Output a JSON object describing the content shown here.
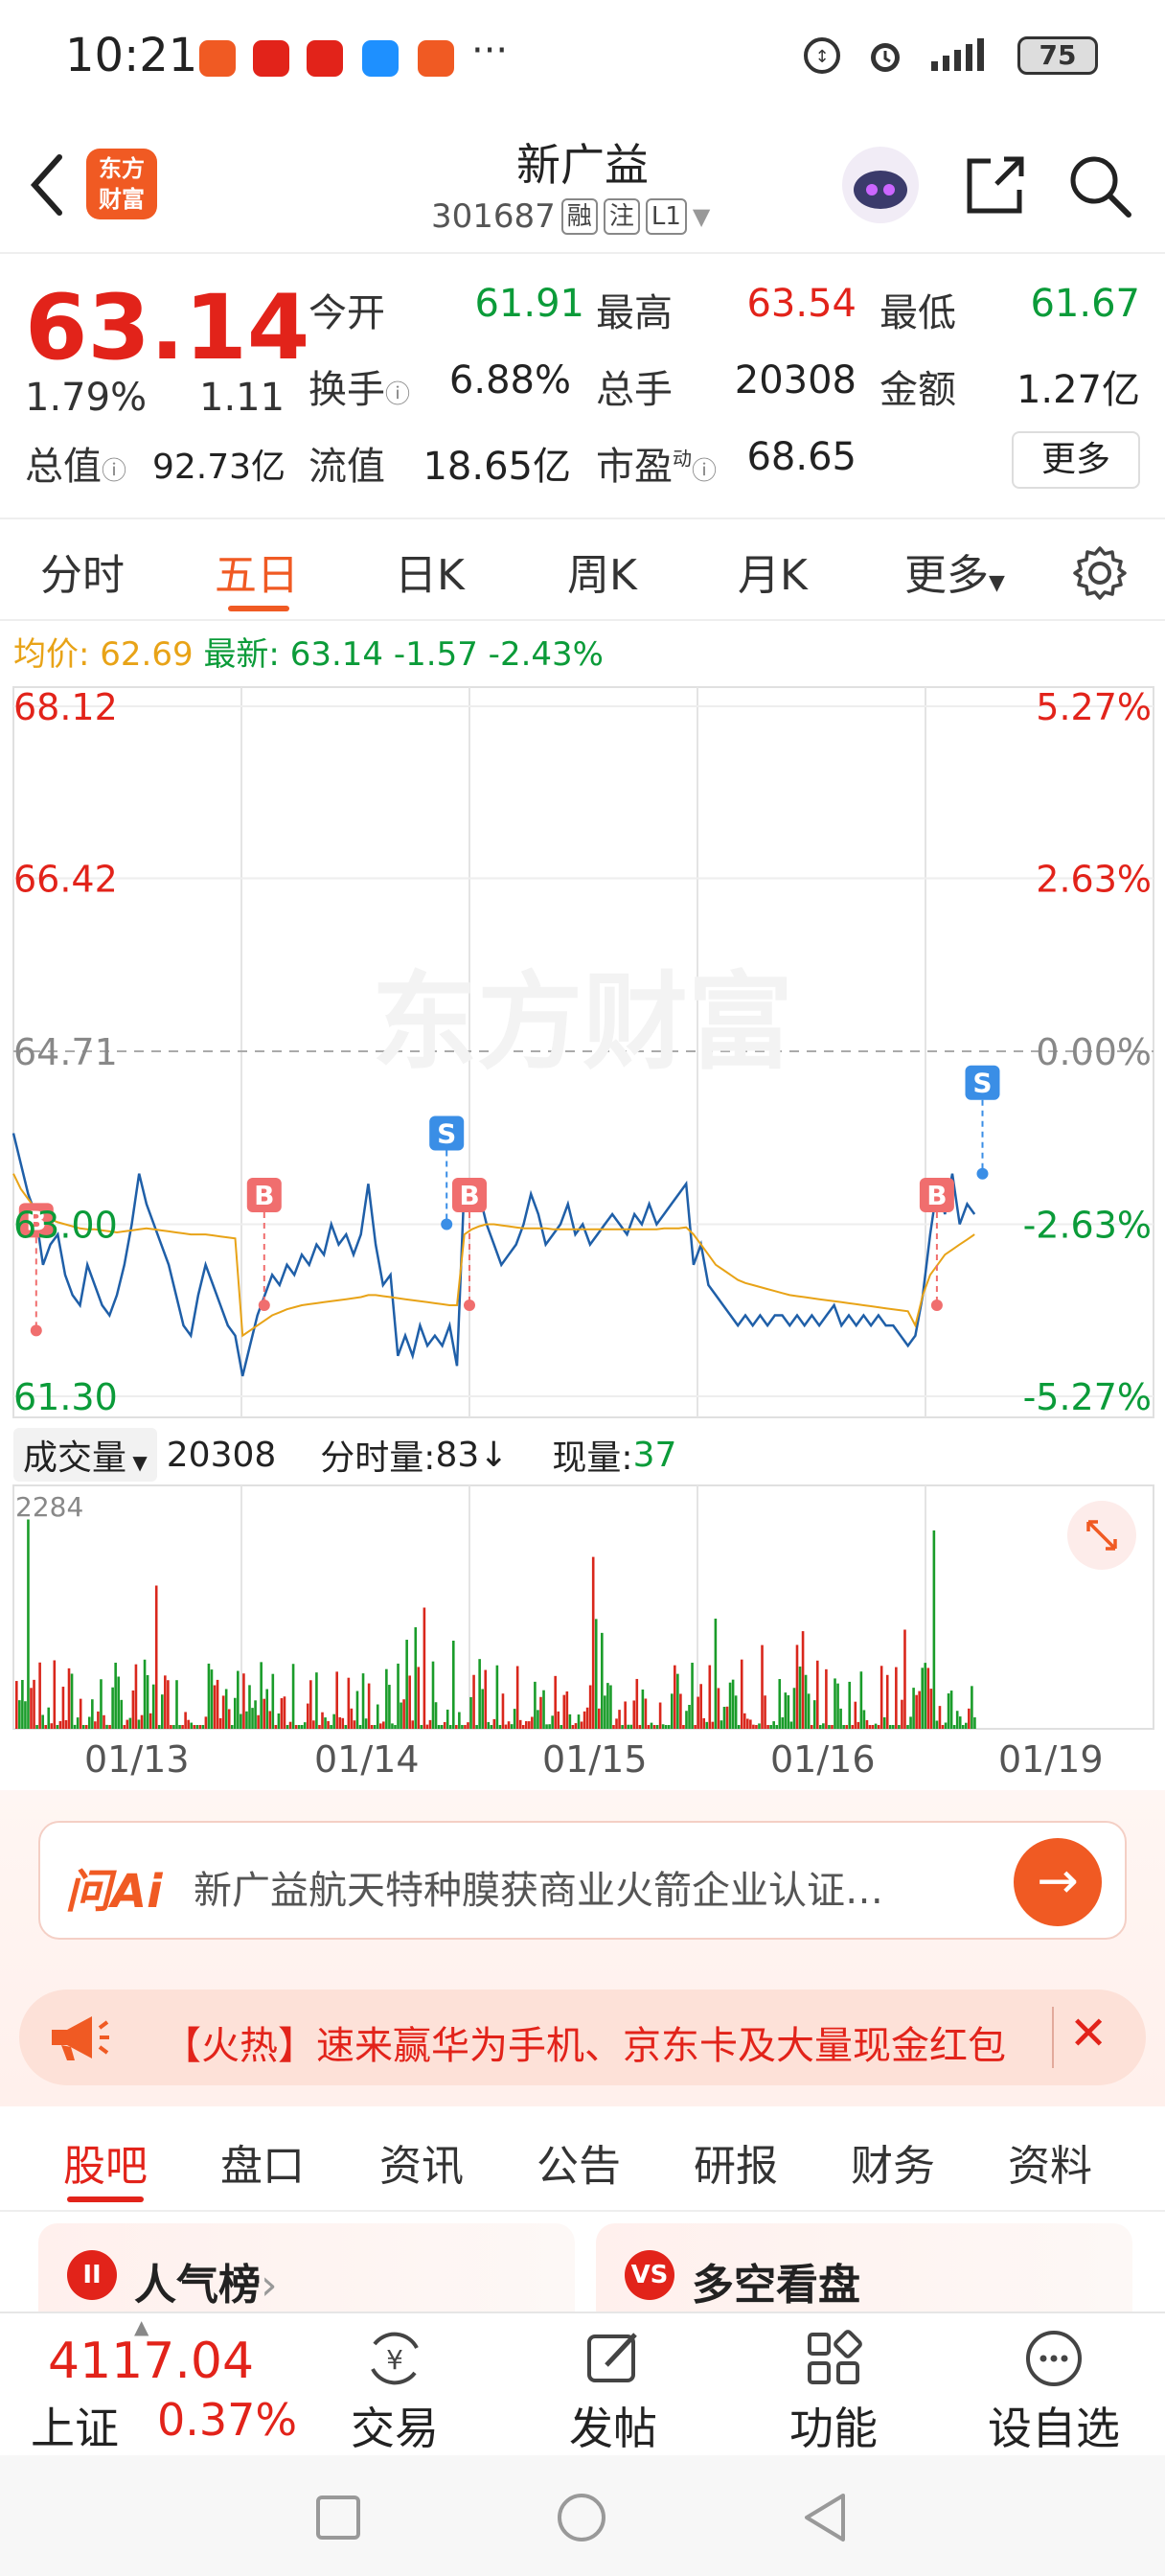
{
  "status_bar": {
    "time": "10:21",
    "dots": "···",
    "battery": "75",
    "app_icons": [
      "#f05a23",
      "#e2231a",
      "#e2231a",
      "#1e90ff",
      "#f05a23"
    ]
  },
  "header": {
    "logo_text_line1": "东方",
    "logo_text_line2": "财富",
    "stock_name": "新广益",
    "stock_code": "301687",
    "tag_margin": "融",
    "tag_watch": "注",
    "tag_level": "L1"
  },
  "quote": {
    "price": "63.14",
    "change_pct": "1.79%",
    "change_amt": "1.11",
    "open_label": "今开",
    "open": "61.91",
    "high_label": "最高",
    "high": "63.54",
    "low_label": "最低",
    "low": "61.67",
    "turnover_label": "换手",
    "turnover": "6.88%",
    "volume_label": "总手",
    "volume": "20308",
    "amount_label": "金额",
    "amount": "1.27亿",
    "mktcap_label": "总值",
    "mktcap": "92.73亿",
    "float_label": "流值",
    "float": "18.65亿",
    "pe_label": "市盈",
    "pe_sup": "动",
    "pe": "68.65",
    "more": "更多"
  },
  "period_tabs": [
    "分时",
    "五日",
    "日K",
    "周K",
    "月K",
    "更多"
  ],
  "active_period": 1,
  "info_line": {
    "avg_label": "均价:",
    "avg": "62.69",
    "latest_label": "最新:",
    "latest": "63.14",
    "chg": "-1.57",
    "chg_pct": "-2.43%"
  },
  "watermark": "东方财富",
  "chart_data": {
    "type": "line",
    "title": "",
    "y_labels_left": [
      "68.12",
      "66.42",
      "64.71",
      "63.00",
      "61.30"
    ],
    "y_labels_right": [
      "5.27%",
      "2.63%",
      "0.00%",
      "-2.63%",
      "-5.27%"
    ],
    "ylim": [
      61.3,
      68.12
    ],
    "days": [
      "01/13",
      "01/14",
      "01/15",
      "01/16",
      "01/19"
    ],
    "series": [
      {
        "values": [
          63.9,
          63.6,
          63.3,
          63.1,
          62.6,
          62.8,
          62.9,
          62.5,
          62.3,
          62.2,
          62.6,
          62.4,
          62.2,
          62.1,
          62.3,
          62.6,
          63.0,
          63.5,
          63.2,
          63.0,
          62.8,
          62.6,
          62.3,
          62.0,
          61.9,
          62.3,
          62.6,
          62.4,
          62.2,
          62.0,
          61.9,
          61.5,
          61.8,
          62.1,
          62.3,
          62.5,
          62.4,
          62.6,
          62.5,
          62.7,
          62.6,
          62.8,
          62.7,
          63.0,
          62.8,
          62.9,
          62.7,
          62.9,
          63.4,
          62.8,
          62.4,
          62.5,
          61.7,
          61.9,
          61.7,
          62.0,
          61.8,
          61.9,
          61.8,
          62.0,
          61.6,
          63.4,
          63.2,
          63.3,
          63.0,
          62.8,
          62.6,
          62.7,
          62.8,
          63.0,
          63.3,
          63.1,
          62.8,
          62.9,
          63.0,
          63.2,
          62.9,
          63.0,
          62.8,
          62.9,
          63.0,
          63.1,
          63.0,
          62.9,
          63.1,
          63.0,
          63.2,
          63.0,
          63.1,
          63.2,
          63.3,
          63.4,
          62.6,
          62.8,
          62.4,
          62.3,
          62.2,
          62.1,
          62.0,
          62.1,
          62.0,
          62.1,
          62.0,
          62.1,
          62.1,
          62.0,
          62.1,
          62.0,
          62.1,
          62.0,
          62.1,
          62.2,
          62.0,
          62.1,
          62.0,
          62.1,
          62.0,
          62.1,
          62.0,
          62.0,
          61.9,
          61.8,
          61.9,
          62.3,
          62.9,
          63.4,
          63.1,
          63.5,
          63.0,
          63.2,
          63.1
        ]
      },
      {
        "values": [
          63.5,
          63.35,
          63.25,
          63.15,
          63.1,
          63.05,
          63.02,
          63.0,
          62.98,
          62.96,
          62.95,
          62.95,
          62.94,
          62.93,
          62.92,
          62.93,
          62.94,
          62.95,
          62.96,
          62.95,
          62.94,
          62.93,
          62.92,
          62.91,
          62.9,
          62.9,
          62.9,
          62.89,
          62.88,
          62.87,
          62.86,
          61.9,
          61.95,
          62.0,
          62.05,
          62.1,
          62.13,
          62.16,
          62.18,
          62.2,
          62.21,
          62.22,
          62.23,
          62.24,
          62.25,
          62.26,
          62.27,
          62.28,
          62.3,
          62.3,
          62.29,
          62.28,
          62.27,
          62.26,
          62.25,
          62.24,
          62.23,
          62.22,
          62.21,
          62.2,
          62.2,
          62.9,
          62.95,
          62.98,
          63.0,
          63.0,
          62.99,
          62.98,
          62.97,
          62.96,
          62.96,
          62.96,
          62.96,
          62.95,
          62.95,
          62.95,
          62.95,
          62.95,
          62.95,
          62.95,
          62.95,
          62.95,
          62.95,
          62.95,
          62.95,
          62.95,
          62.95,
          62.95,
          62.96,
          62.96,
          62.96,
          62.97,
          62.9,
          62.8,
          62.7,
          62.6,
          62.55,
          62.5,
          62.45,
          62.42,
          62.4,
          62.38,
          62.36,
          62.34,
          62.32,
          62.3,
          62.29,
          62.28,
          62.27,
          62.26,
          62.25,
          62.24,
          62.23,
          62.22,
          62.21,
          62.2,
          62.19,
          62.18,
          62.17,
          62.16,
          62.15,
          62.14,
          62.0,
          62.3,
          62.5,
          62.6,
          62.7,
          62.75,
          62.8,
          62.85,
          62.9
        ]
      }
    ],
    "markers": [
      {
        "label": "B",
        "day_pos": 0.02,
        "price": 61.95
      },
      {
        "label": "B",
        "day_pos": 0.22,
        "price": 62.2
      },
      {
        "label": "S",
        "day_pos": 0.38,
        "price": 63.0
      },
      {
        "label": "B",
        "day_pos": 0.4,
        "price": 62.2
      },
      {
        "label": "B",
        "day_pos": 0.81,
        "price": 62.2
      },
      {
        "label": "S",
        "day_pos": 0.85,
        "price": 63.5
      }
    ]
  },
  "volume": {
    "select_label": "成交量",
    "total": "20308",
    "tick_label": "分时量:",
    "tick_value": "83",
    "tick_arrow": "↓",
    "now_label": "现量:",
    "now_value": "37",
    "max_label": "2284",
    "expand_icon": "expand-icon"
  },
  "ai": {
    "logo": "问Ai",
    "text": "新广益航天特种膜获商业火箭企业认证…",
    "go": "→"
  },
  "promo": {
    "text": "【火热】速来赢华为手机、京东卡及大量现金红包",
    "close": "✕"
  },
  "content_tabs": [
    "股吧",
    "盘口",
    "资讯",
    "公告",
    "研报",
    "财务",
    "资料"
  ],
  "active_content_tab": 0,
  "cards": [
    {
      "title": "人气榜",
      "suffix": "›",
      "icon": "II"
    },
    {
      "title": "多空看盘",
      "icon": "VS"
    }
  ],
  "bottom_nav": {
    "index_value": "4117.04",
    "index_name": "上证",
    "index_pct": "0.37%",
    "items": [
      {
        "label": "交易",
        "icon": "yen-icon"
      },
      {
        "label": "发帖",
        "icon": "edit-icon"
      },
      {
        "label": "功能",
        "icon": "grid-icon"
      },
      {
        "label": "设自选",
        "icon": "more-icon"
      }
    ]
  }
}
